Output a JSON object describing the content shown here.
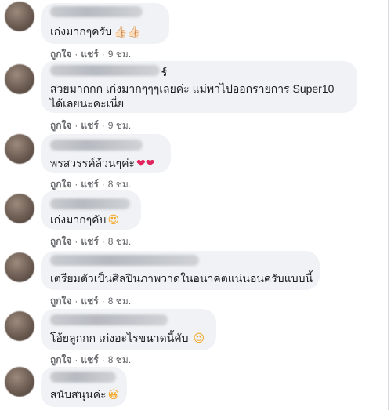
{
  "comments": [
    {
      "text": "เก่งมากๆครับ",
      "emoji": "👍🏻👍🏻",
      "like": "ถูกใจ",
      "share": "แชร์",
      "time": "9 ชม.",
      "dot": "·"
    },
    {
      "name_tail": "ร์",
      "text_line1": "สวยมากกก เก่งมากๆๆๆเลยค่ะ แม่พาไปออกรายการ Super10",
      "text_line2": "ได้เลยนะคะเนี่ย",
      "like": "ถูกใจ",
      "share": "แชร์",
      "time": "9 ชม.",
      "dot": "·"
    },
    {
      "text": "พรสวรรค์ล้วนๆค่ะ",
      "emoji": "❤❤",
      "like": "ถูกใจ",
      "share": "แชร์",
      "time": "8 ชม.",
      "dot": "·"
    },
    {
      "text": "เก่งมากๆคับ",
      "emoji": "😍",
      "like": "ถูกใจ",
      "share": "แชร์",
      "time": "8 ชม.",
      "dot": "·"
    },
    {
      "text": "เตรียมตัวเป็นศิลปินภาพวาดในอนาคตแน่นอนครับแบบนี้",
      "like": "ถูกใจ",
      "share": "แชร์",
      "time": "8 ชม.",
      "dot": "·"
    },
    {
      "text": "โอ้ยลูกกก เก่งอะไรขนาดนี้คับ",
      "emoji": "😍",
      "like": "ถูกใจ",
      "share": "แชร์",
      "time": "8 ชม.",
      "dot": "·"
    },
    {
      "text": "สนับสนุนค่ะ",
      "emoji": "😀"
    }
  ]
}
